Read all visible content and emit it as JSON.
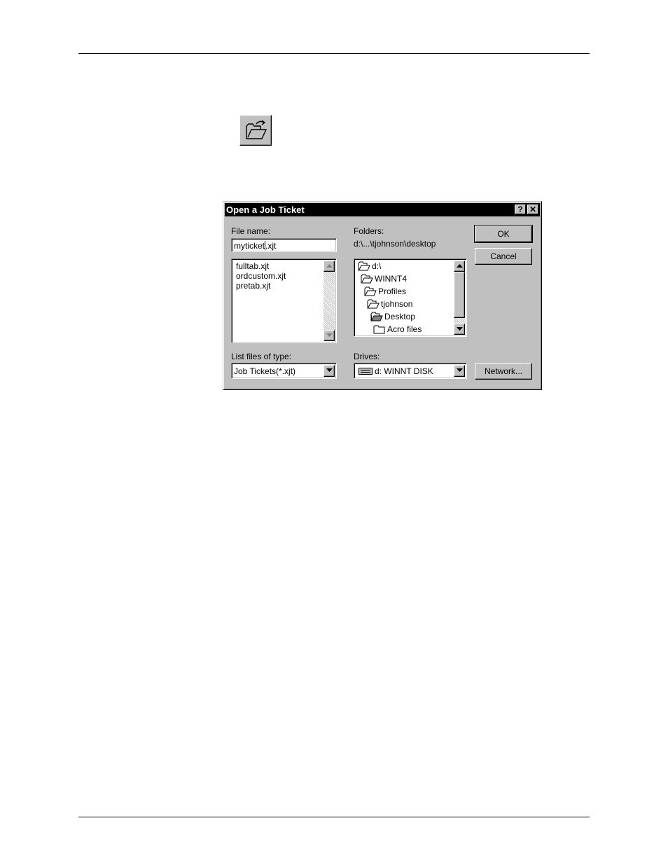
{
  "toolbar": {
    "open_icon": "open-folder-icon"
  },
  "dialog": {
    "title": "Open a Job Ticket",
    "help_button": "?",
    "close_button": "✕",
    "file_name_label": "File name:",
    "file_name_value_before_caret": "myticket",
    "file_name_value_after_caret": ".xjt",
    "files": [
      "fulltab.xjt",
      "ordcustom.xjt",
      "pretab.xjt"
    ],
    "folders_label": "Folders:",
    "current_path": "d:\\...\\tjohnson\\desktop",
    "folders": [
      {
        "name": "d:\\",
        "icon": "open-folder-icon"
      },
      {
        "name": "WINNT4",
        "icon": "open-folder-icon"
      },
      {
        "name": "Profiles",
        "icon": "open-folder-icon"
      },
      {
        "name": "tjohnson",
        "icon": "open-folder-icon"
      },
      {
        "name": "Desktop",
        "icon": "open-folder-icon"
      },
      {
        "name": "Acro files",
        "icon": "closed-folder-icon"
      }
    ],
    "ok_label": "OK",
    "cancel_label": "Cancel",
    "list_files_label": "List files of type:",
    "file_type_value": "Job Tickets(*.xjt)",
    "drives_label": "Drives:",
    "drive_value": "d: WINNT DISK",
    "network_label": "Network..."
  },
  "colors": {
    "face": "#c0c0c0",
    "titlebar": "#000000",
    "field": "#ffffff"
  }
}
